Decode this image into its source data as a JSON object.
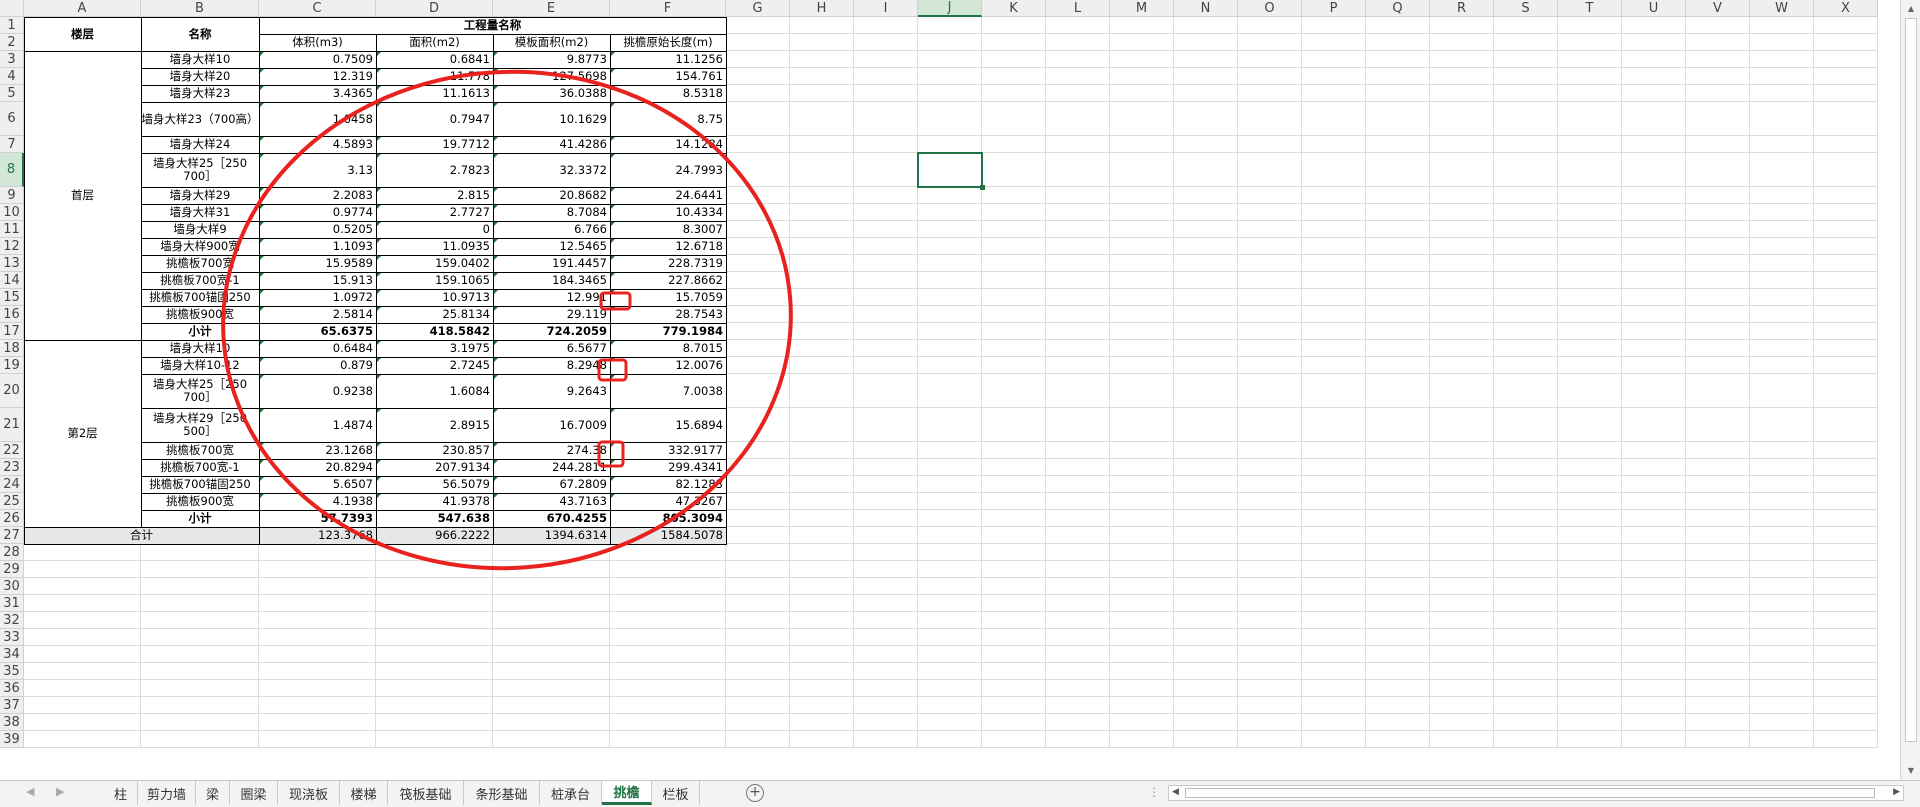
{
  "columns": [
    "A",
    "B",
    "C",
    "D",
    "E",
    "F",
    "G",
    "H",
    "I",
    "J",
    "K",
    "L",
    "M",
    "N",
    "O",
    "P",
    "Q",
    "R",
    "S",
    "T",
    "U",
    "V",
    "W",
    "X"
  ],
  "rows": [
    "1",
    "2",
    "3",
    "4",
    "5",
    "6",
    "7",
    "8",
    "9",
    "10",
    "11",
    "12",
    "13",
    "14",
    "15",
    "16",
    "17",
    "18",
    "19",
    "20",
    "21",
    "22",
    "23",
    "24",
    "25",
    "26",
    "27",
    "28",
    "29",
    "30",
    "31",
    "32",
    "33",
    "34",
    "35",
    "36",
    "37",
    "38",
    "39"
  ],
  "selected_cell": "J8",
  "header": {
    "floor": "楼层",
    "name": "名称",
    "group": "工程量名称",
    "c": "体积(m3)",
    "d": "面积(m2)",
    "e": "模板面积(m2)",
    "f": "挑檐原始长度(m)"
  },
  "floors": [
    "首层",
    "第2层"
  ],
  "table": [
    {
      "r": 3,
      "b": "墙身大样10",
      "c": "0.7509",
      "d": "0.6841",
      "e": "9.8773",
      "f": "11.1256"
    },
    {
      "r": 4,
      "b": "墙身大样20",
      "c": "12.319",
      "d": "11.778",
      "e": "127.5698",
      "f": "154.761"
    },
    {
      "r": 5,
      "b": "墙身大样23",
      "c": "3.4365",
      "d": "11.1613",
      "e": "36.0388",
      "f": "8.5318"
    },
    {
      "r": 6,
      "b": "墙身大样23（700高）",
      "c": "1.0458",
      "d": "0.7947",
      "e": "10.1629",
      "f": "8.75"
    },
    {
      "r": 7,
      "b": "墙身大样24",
      "c": "4.5893",
      "d": "19.7712",
      "e": "41.4286",
      "f": "14.1284"
    },
    {
      "r": 8,
      "b": "墙身大样25［250 700］",
      "c": "3.13",
      "d": "2.7823",
      "e": "32.3372",
      "f": "24.7993"
    },
    {
      "r": 9,
      "b": "墙身大样29",
      "c": "2.2083",
      "d": "2.815",
      "e": "20.8682",
      "f": "24.6441"
    },
    {
      "r": 10,
      "b": "墙身大样31",
      "c": "0.9774",
      "d": "2.7727",
      "e": "8.7084",
      "f": "10.4334"
    },
    {
      "r": 11,
      "b": "墙身大样9",
      "c": "0.5205",
      "d": "0",
      "e": "6.766",
      "f": "8.3007"
    },
    {
      "r": 12,
      "b": "墙身大样900宽",
      "c": "1.1093",
      "d": "11.0935",
      "e": "12.5465",
      "f": "12.6718"
    },
    {
      "r": 13,
      "b": "挑檐板700宽",
      "c": "15.9589",
      "d": "159.0402",
      "e": "191.4457",
      "f": "228.7319"
    },
    {
      "r": 14,
      "b": "挑檐板700宽-1",
      "c": "15.913",
      "d": "159.1065",
      "e": "184.3465",
      "f": "227.8662"
    },
    {
      "r": 15,
      "b": "挑檐板700锚固250",
      "c": "1.0972",
      "d": "10.9713",
      "e": "12.991",
      "f": "15.7059"
    },
    {
      "r": 16,
      "b": "挑檐板900宽",
      "c": "2.5814",
      "d": "25.8134",
      "e": "29.119",
      "f": "28.7543"
    },
    {
      "r": 17,
      "b": "小计",
      "c": "65.6375",
      "d": "418.5842",
      "e": "724.2059",
      "f": "779.1984",
      "bold": true
    },
    {
      "r": 18,
      "b": "墙身大样10",
      "c": "0.6484",
      "d": "3.1975",
      "e": "6.5677",
      "f": "8.7015"
    },
    {
      "r": 19,
      "b": "墙身大样10-12",
      "c": "0.879",
      "d": "2.7245",
      "e": "8.2948",
      "f": "12.0076"
    },
    {
      "r": 20,
      "b": "墙身大样25［250 700］",
      "c": "0.9238",
      "d": "1.6084",
      "e": "9.2643",
      "f": "7.0038"
    },
    {
      "r": 21,
      "b": "墙身大样29［250 500］",
      "c": "1.4874",
      "d": "2.8915",
      "e": "16.7009",
      "f": "15.6894"
    },
    {
      "r": 22,
      "b": "挑檐板700宽",
      "c": "23.1268",
      "d": "230.857",
      "e": "274.38",
      "f": "332.9177"
    },
    {
      "r": 23,
      "b": "挑檐板700宽-1",
      "c": "20.8294",
      "d": "207.9134",
      "e": "244.2811",
      "f": "299.4341"
    },
    {
      "r": 24,
      "b": "挑檐板700锚固250",
      "c": "5.6507",
      "d": "56.5079",
      "e": "67.2809",
      "f": "82.1283"
    },
    {
      "r": 25,
      "b": "挑檐板900宽",
      "c": "4.1938",
      "d": "41.9378",
      "e": "43.7163",
      "f": "47.3267"
    },
    {
      "r": 26,
      "b": "小计",
      "c": "57.7393",
      "d": "547.638",
      "e": "670.4255",
      "f": "805.3094",
      "bold": true
    },
    {
      "r": 27,
      "b": "合计",
      "c": "123.3768",
      "d": "966.2222",
      "e": "1394.6314",
      "f": "1584.5078",
      "total": true
    }
  ],
  "tabs": [
    "柱",
    "剪力墙",
    "梁",
    "圈梁",
    "现浇板",
    "楼梯",
    "筏板基础",
    "条形基础",
    "桩承台",
    "挑檐",
    "栏板"
  ],
  "active_tab": "挑檐",
  "annotation_color": "#e8231f",
  "accent_color": "#217346"
}
